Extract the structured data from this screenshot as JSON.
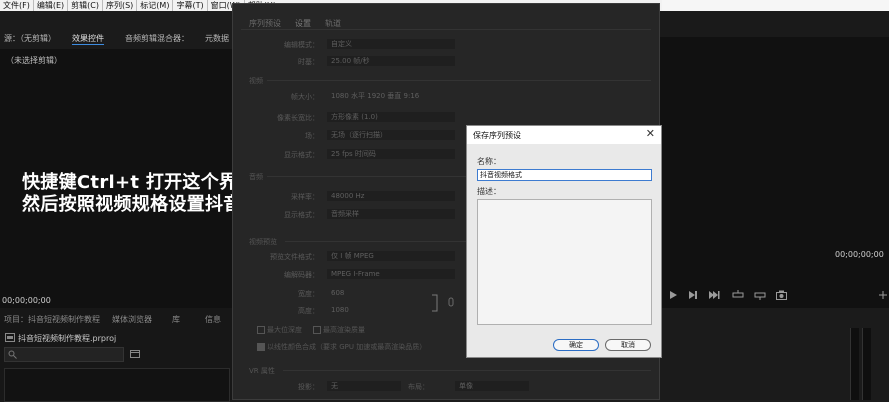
{
  "menu": [
    "文件(F)",
    "编辑(E)",
    "剪辑(C)",
    "序列(S)",
    "标记(M)",
    "字幕(T)",
    "窗口(W)",
    "帮助(H)"
  ],
  "source_panel": {
    "tabs": [
      "源：（无剪辑）",
      "效果控件",
      "音频剪辑混合器：",
      "元数据"
    ],
    "subtitle": "（未选择剪辑）",
    "timecode": "00;00;00;00"
  },
  "caption": {
    "line1": "快捷键Ctrl+t 打开这个界面",
    "line2": "然后按照视频规格设置抖音格式"
  },
  "project_panel": {
    "tabs": [
      "项目：抖音短视频制作教程",
      "媒体浏览器",
      "库",
      "信息"
    ],
    "file": "抖音短视频制作教程.prproj"
  },
  "sequence_dialog": {
    "tabs": [
      "序列预设",
      "设置",
      "轨道"
    ],
    "rows": [
      {
        "label": "编辑模式：",
        "value": "自定义"
      },
      {
        "label": "时基：",
        "value": "25.00 帧/秒"
      },
      {
        "label": "帧大小：",
        "value": "1080   水平   1920   垂直   9:16"
      },
      {
        "label": "像素长宽比：",
        "value": "方形像素 (1.0)"
      },
      {
        "label": "场：",
        "value": "无场（逐行扫描）"
      },
      {
        "label": "显示格式：",
        "value": "25 fps 时间码"
      },
      {
        "label": "采样率：",
        "value": "48000 Hz"
      },
      {
        "label": "显示格式：",
        "value": "音频采样"
      },
      {
        "label": "预览文件格式：",
        "value": "仅 I 帧 MPEG"
      },
      {
        "label": "编解码器：",
        "value": "MPEG I-Frame"
      },
      {
        "label": "宽度：",
        "value": "608"
      },
      {
        "label": "高度：",
        "value": "1080"
      }
    ],
    "sections": [
      "视频",
      "音频",
      "视频预览",
      "VR 属性"
    ],
    "checks": [
      "最大位深度",
      "最高渲染质量",
      "以线性颜色合成（要求 GPU 加速或最高渲染品质）"
    ],
    "vr": {
      "label1": "投影：",
      "value1": "无",
      "label2": "布局：",
      "value2": "单像"
    }
  },
  "program_panel": {
    "timecode": "00;00;00;00"
  },
  "save_preset": {
    "title": "保存序列预设",
    "name_label": "名称：",
    "name_value": "抖音视频格式",
    "desc_label": "描述：",
    "ok_label": "确定",
    "cancel_label": "取消"
  },
  "colors": {
    "accent": "#3d7bd0",
    "panel_bg": "#111111",
    "dialog_bg": "#e9e9e9"
  }
}
